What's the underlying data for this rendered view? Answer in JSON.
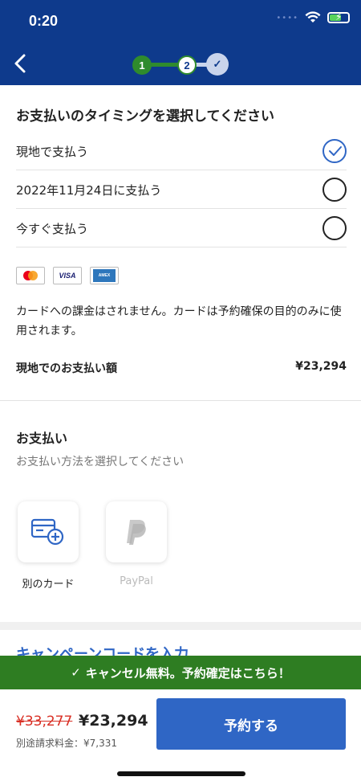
{
  "status_bar": {
    "time": "0:20"
  },
  "header": {
    "steps": [
      {
        "label": "1",
        "state": "done"
      },
      {
        "label": "2",
        "state": "current"
      },
      {
        "label": "✓",
        "state": "pending"
      }
    ]
  },
  "timing": {
    "title": "お支払いのタイミングを選択してください",
    "options": [
      {
        "label": "現地で支払う",
        "selected": true
      },
      {
        "label": "2022年11月24日に支払う",
        "selected": false
      },
      {
        "label": "今すぐ支払う",
        "selected": false
      }
    ],
    "card_brands": [
      "mastercard",
      "visa",
      "amex"
    ],
    "visa_text": "VISA",
    "note": "カードへの課金はされません。カードは予約確保の目的のみに使用されます。",
    "amount_label": "現地でのお支払い額",
    "amount_value": "¥23,294"
  },
  "payment": {
    "title": "お支払い",
    "subtitle": "お支払い方法を選択してください",
    "methods": [
      {
        "label": "別のカード",
        "icon": "add-card-icon"
      },
      {
        "label": "PayPal",
        "icon": "paypal-icon"
      }
    ],
    "campaign_link": "キャンペーンコードを入力"
  },
  "banner": {
    "text": "キャンセル無料。予約確定はこちら！"
  },
  "footer": {
    "old_price": "¥33,277",
    "new_price": "¥23,294",
    "extra_fee": "別途請求料金：¥7,331",
    "book_label": "予約する"
  },
  "colors": {
    "header": "#0e3a8c",
    "accent": "#2f66c5",
    "green": "#2e7d22",
    "strike": "#d93025"
  }
}
